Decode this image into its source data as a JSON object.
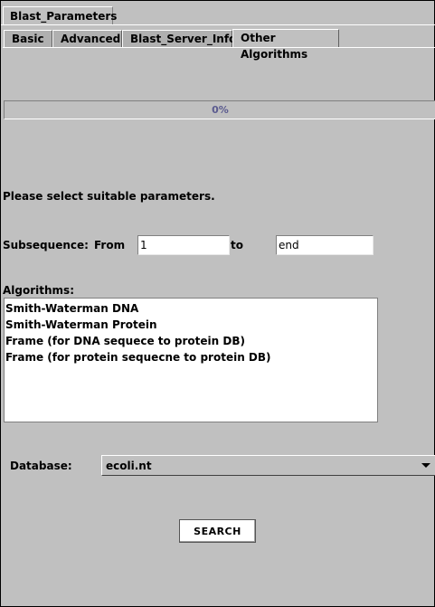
{
  "outer_tab": {
    "label": "Blast_Parameters"
  },
  "tabs": [
    {
      "label": "Basic",
      "active": false
    },
    {
      "label": "Advanced",
      "active": false
    },
    {
      "label": "Blast_Server_Info",
      "active": false
    },
    {
      "label": "Other Algorithms",
      "active": true
    }
  ],
  "progress": {
    "text": "0%",
    "fraction": 0
  },
  "instruction": "Please select suitable parameters.",
  "subsequence": {
    "label": "Subsequence:",
    "from_label": "From",
    "from_value": "1",
    "to_label": "to",
    "to_value": "end"
  },
  "algorithms": {
    "label": "Algorithms:",
    "items": [
      "Smith-Waterman DNA",
      "Smith-Waterman Protein",
      "Frame (for DNA sequece to protein DB)",
      "Frame (for protein sequecne to protein DB)"
    ]
  },
  "database": {
    "label": "Database:",
    "selected": "ecoli.nt"
  },
  "search_button": {
    "label": "SEARCH"
  },
  "colors": {
    "panel": "#c0c0c0",
    "progress_text": "#5b5b8f",
    "field_bg": "#ffffff"
  }
}
